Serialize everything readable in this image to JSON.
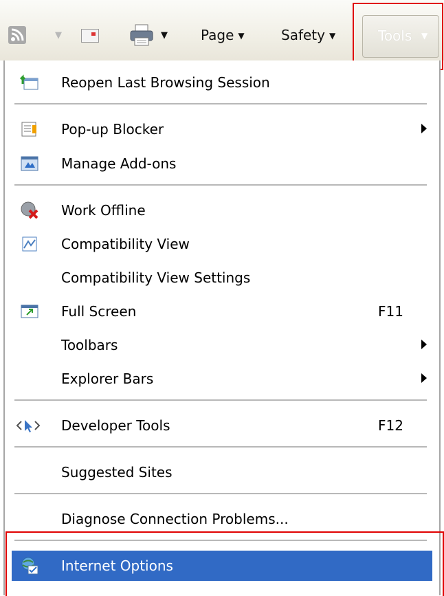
{
  "toolbar": {
    "page_label": "Page",
    "safety_label": "Safety",
    "tools_label": "Tools"
  },
  "menu": {
    "items": [
      {
        "label": "Reopen Last Browsing Session",
        "shortcut": "",
        "submenu": false,
        "icon": "reopen-session-icon"
      },
      {
        "label": "Pop-up Blocker",
        "shortcut": "",
        "submenu": true,
        "icon": "popup-blocker-icon"
      },
      {
        "label": "Manage Add-ons",
        "shortcut": "",
        "submenu": false,
        "icon": "manage-addons-icon"
      },
      {
        "label": "Work Offline",
        "shortcut": "",
        "submenu": false,
        "icon": "work-offline-icon"
      },
      {
        "label": "Compatibility View",
        "shortcut": "",
        "submenu": false,
        "icon": "compatibility-view-icon"
      },
      {
        "label": "Compatibility View Settings",
        "shortcut": "",
        "submenu": false,
        "icon": ""
      },
      {
        "label": "Full Screen",
        "shortcut": "F11",
        "submenu": false,
        "icon": "full-screen-icon"
      },
      {
        "label": "Toolbars",
        "shortcut": "",
        "submenu": true,
        "icon": ""
      },
      {
        "label": "Explorer Bars",
        "shortcut": "",
        "submenu": true,
        "icon": ""
      },
      {
        "label": "Developer Tools",
        "shortcut": "F12",
        "submenu": false,
        "icon": "developer-tools-icon"
      },
      {
        "label": "Suggested Sites",
        "shortcut": "",
        "submenu": false,
        "icon": ""
      },
      {
        "label": "Diagnose Connection Problems...",
        "shortcut": "",
        "submenu": false,
        "icon": ""
      },
      {
        "label": "Internet Options",
        "shortcut": "",
        "submenu": false,
        "icon": "internet-options-icon",
        "highlighted": true
      }
    ]
  },
  "colors": {
    "highlight": "#316ac5",
    "annotation_red": "#e00000"
  }
}
